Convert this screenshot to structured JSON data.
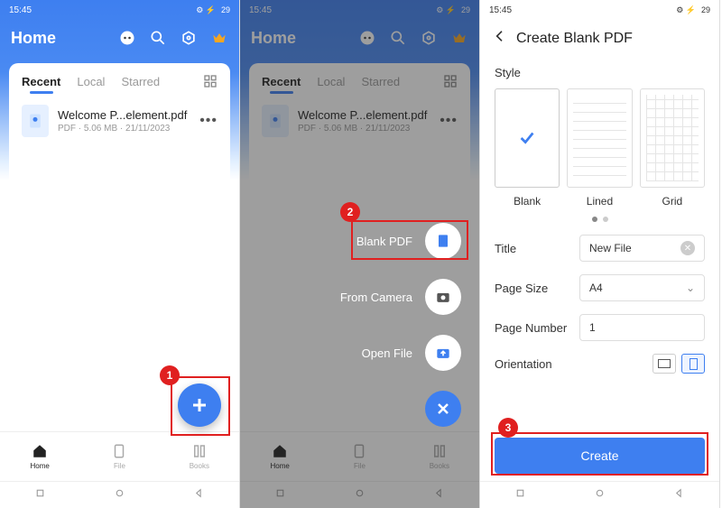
{
  "status": {
    "time": "15:45",
    "battery": "29"
  },
  "home": {
    "title": "Home",
    "tabs": [
      "Recent",
      "Local",
      "Starred"
    ],
    "file": {
      "name": "Welcome P...element.pdf",
      "meta": "PDF · 5.06 MB · 21/11/2023"
    },
    "nav": {
      "home": "Home",
      "file": "File",
      "books": "Books"
    }
  },
  "actions": {
    "blank_pdf": "Blank PDF",
    "from_camera": "From Camera",
    "open_file": "Open File"
  },
  "create": {
    "header": "Create Blank PDF",
    "style_label": "Style",
    "styles": {
      "blank": "Blank",
      "lined": "Lined",
      "grid": "Grid"
    },
    "title_label": "Title",
    "title_value": "New File",
    "page_size_label": "Page Size",
    "page_size_value": "A4",
    "page_number_label": "Page Number",
    "page_number_value": "1",
    "orientation_label": "Orientation",
    "create_btn": "Create"
  },
  "badges": {
    "b1": "1",
    "b2": "2",
    "b3": "3"
  }
}
